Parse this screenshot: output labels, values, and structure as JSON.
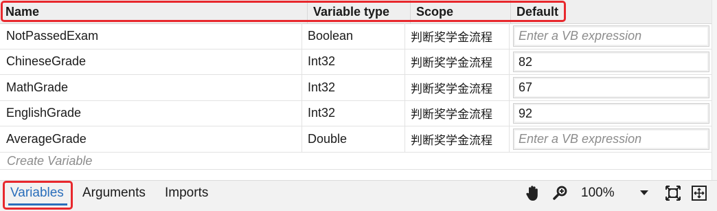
{
  "header": {
    "name": "Name",
    "variable_type": "Variable type",
    "scope": "Scope",
    "default": "Default"
  },
  "rows": [
    {
      "name": "NotPassedExam",
      "type": "Boolean",
      "scope": "判断奖学金流程",
      "default": "",
      "default_placeholder": "Enter a VB expression"
    },
    {
      "name": "ChineseGrade",
      "type": "Int32",
      "scope": "判断奖学金流程",
      "default": "82",
      "default_placeholder": ""
    },
    {
      "name": "MathGrade",
      "type": "Int32",
      "scope": "判断奖学金流程",
      "default": "67",
      "default_placeholder": ""
    },
    {
      "name": "EnglishGrade",
      "type": "Int32",
      "scope": "判断奖学金流程",
      "default": "92",
      "default_placeholder": ""
    },
    {
      "name": "AverageGrade",
      "type": "Double",
      "scope": "判断奖学金流程",
      "default": "",
      "default_placeholder": "Enter a VB expression"
    }
  ],
  "create_variable": "Create Variable",
  "tabs": [
    "Variables",
    "Arguments",
    "Imports"
  ],
  "active_tab": "Variables",
  "zoom": "100%",
  "colors": {
    "highlight": "#e8282d",
    "accent": "#2a6ebb"
  }
}
